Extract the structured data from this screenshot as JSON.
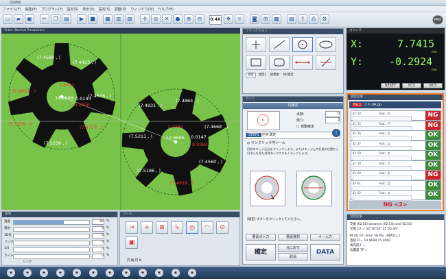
{
  "window": {
    "title": "QSPAK"
  },
  "menu": [
    "ファイル(F)",
    "編集(E)",
    "プログラム(P)",
    "設定(S)",
    "表示(V)",
    "設定(S)",
    "調整(O)",
    "ウィンドウ(W)",
    "ヘルプ(H)"
  ],
  "toolbar": {
    "zoom_value": "0.4X"
  },
  "video": {
    "header": "Video (Normal Resolution)",
    "left_gear": {
      "labels": [
        "(7.4580 , )",
        "(7.4423 , )",
        "(7.4638 , )",
        "(7.4777 , )",
        "(7.5230 , )",
        "(7.5359 , )",
        "(7.4951 , )"
      ],
      "red_labels": [
        "1.6411",
        "0.1000"
      ],
      "center_value": "14.9699",
      "center_small": "0.0144",
      "red_flag_indices": [
        3,
        5,
        6
      ]
    },
    "right_gear": {
      "labels": [
        "(7.4931 , )",
        "(7.4864 , )",
        "(7.4668 , )",
        "(7.4560 , )",
        "(7.4919 , )",
        "(7.5186 , )",
        "(7.5211 , )"
      ],
      "red_labels": [
        "1.7294",
        "0.0384"
      ],
      "center_value": "13.8686",
      "center_small": "0.0147",
      "red_flag_indices": [
        4
      ]
    }
  },
  "functions": {
    "header": "ファンクション",
    "tabs": [
      "測定",
      "測定2",
      "座標系",
      "NP測定"
    ]
  },
  "coords": {
    "header": "カウンタ",
    "x_label": "X:",
    "x_value": "7.7415",
    "x_unit": "mm",
    "y_label": "Y:",
    "y_value": "-0.2924",
    "y_unit": "mm",
    "buttons": [
      "RESET",
      "PCS",
      "MCS"
    ]
  },
  "guide": {
    "header": "ガイド",
    "title": "円測定",
    "points_label": "点数:",
    "points_value": "0",
    "remaining_label": "残り:",
    "remaining_value": "3",
    "auto_label": "自動確定",
    "step_tag": "STEP1",
    "step_text": "円を測定",
    "tool_name": "ワンクリック円ツール",
    "instruction": "円状のエッジ近辺をクリックします。またはエッジ上の任意の位置から円中心を見た対称点へマウスをドラッグします。",
    "confirm_hint": "[確定] ボタンをクリックしてください。",
    "buttons": {
      "b1": "要素点入力",
      "b2": "要素選択",
      "b3": "キー入力",
      "confirm": "確定",
      "undo": "元に戻す",
      "cancel": "取消",
      "data": "DATA"
    }
  },
  "results": {
    "header": "測定結果",
    "title_no": "No.1",
    "title_file": "ファ.d4.pp",
    "rows": [
      {
        "id": "ID: 54",
        "text": "Feat.: 円",
        "status": "NG"
      },
      {
        "id": "ID: 55",
        "text": "Feat.: 円",
        "status": "NG"
      },
      {
        "id": "ID: 56",
        "text": "Feat.: 点",
        "status": "OK"
      },
      {
        "id": "ID: 57",
        "text": "Feat.: 点",
        "status": "OK"
      },
      {
        "id": "ID: 58",
        "text": "Feat.: 点",
        "status": "OK"
      },
      {
        "id": "ID: 59",
        "text": "Feat.: 点",
        "status": "OK"
      },
      {
        "id": "ID: 60",
        "text": "Feat.: 点",
        "status": "NG"
      },
      {
        "id": "ID: 61",
        "text": "Feat.: 点",
        "status": "OK"
      },
      {
        "id": "ID: 62",
        "text": "Feat.: 点",
        "status": "OK"
      }
    ],
    "summary": "NG <2>"
  },
  "log": {
    "header": "測定結果",
    "line1": "交角 (ID:56) between (ID:54) and (ID:55)",
    "line2": "交角    CA =   52°30'54\"   51°25'44\"",
    "line3": "円 (ID:57, From 58 Pts., 円内なし)",
    "line4": "直径    D =   14.9699     15.0000",
    "line5": "真円度  F =",
    "line6": "位置度  TP ="
  },
  "lighting": {
    "header": "照明",
    "rows": [
      {
        "label": "透過",
        "value": "66"
      },
      {
        "label": "落射",
        "value": "0"
      },
      {
        "label": "3D光",
        "value": "0"
      },
      {
        "label": "リング",
        "value": "0"
      },
      {
        "label": "1/4",
        "value": "0"
      },
      {
        "label": "ライト",
        "value": "0"
      }
    ],
    "unit": "%",
    "footer": "リング"
  },
  "tools": {
    "header": "ツール",
    "footer": "円 検 円 N"
  }
}
